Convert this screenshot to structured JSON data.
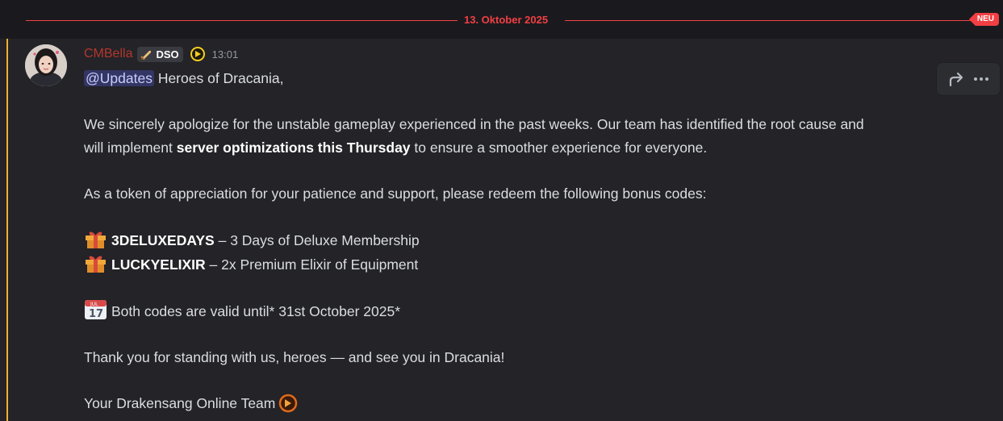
{
  "divider": {
    "date": "13. Oktober 2025",
    "new_label": "NEU"
  },
  "author": {
    "name": "CMBella",
    "tag": "DSO",
    "timestamp": "13:01"
  },
  "mention": "@Updates",
  "lines": {
    "greeting": " Heroes of Dracania,",
    "apology_1": "We sincerely apologize for the unstable gameplay experienced in the past weeks. Our team has identified the root cause and",
    "apology_2_pre": "will implement ",
    "apology_2_bold": "server optimizations this Thursday",
    "apology_2_post": " to ensure a smoother experience for everyone.",
    "appreciation": "As a token of appreciation for your patience and support, please redeem the following bonus codes:",
    "code1_code": "3DELUXEDAYS",
    "code1_desc": " – 3 Days of Deluxe Membership",
    "code2_code": "LUCKYELIXIR",
    "code2_desc": " – 2x Premium Elixir of Equipment",
    "validity": "Both codes are valid until* 31st October 2025*",
    "thanks": "Thank you for standing with us, heroes — and see you in Dracania!",
    "signature": "Your Drakensang Online Team"
  },
  "calendar_emoji": {
    "month": "JUL",
    "day": "17"
  },
  "icons": {
    "gift": "gift-emoji",
    "calendar": "calendar-emoji",
    "forward": "forward-icon",
    "more": "more-icon",
    "role": "drakensang-role-icon",
    "sword": "sword-icon"
  },
  "colors": {
    "accent_red": "#f23f43",
    "username": "#b3372b",
    "highlight": "#f0b232",
    "mention_bg": "#3c4270"
  }
}
